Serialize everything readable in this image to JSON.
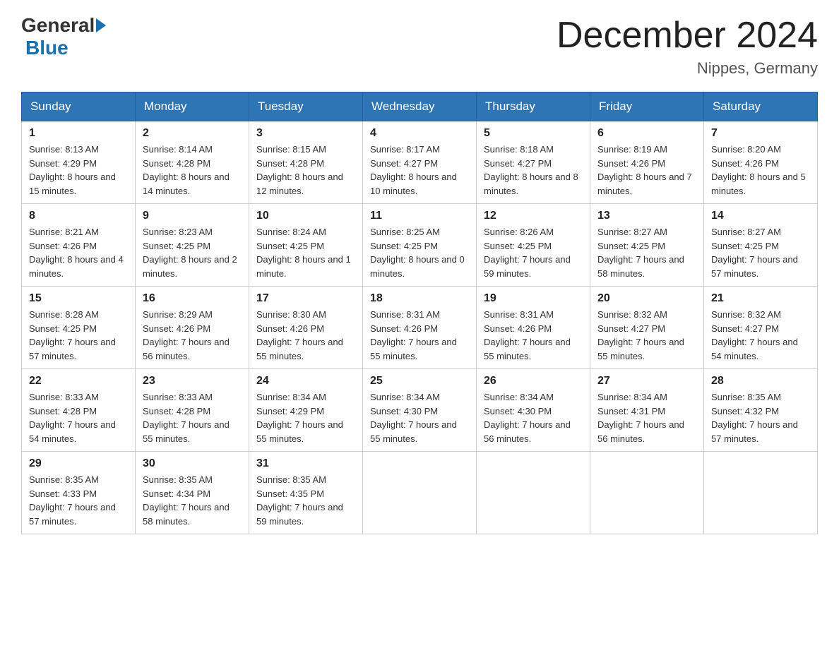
{
  "header": {
    "logo_general": "General",
    "logo_blue": "Blue",
    "month_title": "December 2024",
    "location": "Nippes, Germany"
  },
  "days_of_week": [
    "Sunday",
    "Monday",
    "Tuesday",
    "Wednesday",
    "Thursday",
    "Friday",
    "Saturday"
  ],
  "weeks": [
    [
      {
        "day": "1",
        "sunrise": "Sunrise: 8:13 AM",
        "sunset": "Sunset: 4:29 PM",
        "daylight": "Daylight: 8 hours and 15 minutes."
      },
      {
        "day": "2",
        "sunrise": "Sunrise: 8:14 AM",
        "sunset": "Sunset: 4:28 PM",
        "daylight": "Daylight: 8 hours and 14 minutes."
      },
      {
        "day": "3",
        "sunrise": "Sunrise: 8:15 AM",
        "sunset": "Sunset: 4:28 PM",
        "daylight": "Daylight: 8 hours and 12 minutes."
      },
      {
        "day": "4",
        "sunrise": "Sunrise: 8:17 AM",
        "sunset": "Sunset: 4:27 PM",
        "daylight": "Daylight: 8 hours and 10 minutes."
      },
      {
        "day": "5",
        "sunrise": "Sunrise: 8:18 AM",
        "sunset": "Sunset: 4:27 PM",
        "daylight": "Daylight: 8 hours and 8 minutes."
      },
      {
        "day": "6",
        "sunrise": "Sunrise: 8:19 AM",
        "sunset": "Sunset: 4:26 PM",
        "daylight": "Daylight: 8 hours and 7 minutes."
      },
      {
        "day": "7",
        "sunrise": "Sunrise: 8:20 AM",
        "sunset": "Sunset: 4:26 PM",
        "daylight": "Daylight: 8 hours and 5 minutes."
      }
    ],
    [
      {
        "day": "8",
        "sunrise": "Sunrise: 8:21 AM",
        "sunset": "Sunset: 4:26 PM",
        "daylight": "Daylight: 8 hours and 4 minutes."
      },
      {
        "day": "9",
        "sunrise": "Sunrise: 8:23 AM",
        "sunset": "Sunset: 4:25 PM",
        "daylight": "Daylight: 8 hours and 2 minutes."
      },
      {
        "day": "10",
        "sunrise": "Sunrise: 8:24 AM",
        "sunset": "Sunset: 4:25 PM",
        "daylight": "Daylight: 8 hours and 1 minute."
      },
      {
        "day": "11",
        "sunrise": "Sunrise: 8:25 AM",
        "sunset": "Sunset: 4:25 PM",
        "daylight": "Daylight: 8 hours and 0 minutes."
      },
      {
        "day": "12",
        "sunrise": "Sunrise: 8:26 AM",
        "sunset": "Sunset: 4:25 PM",
        "daylight": "Daylight: 7 hours and 59 minutes."
      },
      {
        "day": "13",
        "sunrise": "Sunrise: 8:27 AM",
        "sunset": "Sunset: 4:25 PM",
        "daylight": "Daylight: 7 hours and 58 minutes."
      },
      {
        "day": "14",
        "sunrise": "Sunrise: 8:27 AM",
        "sunset": "Sunset: 4:25 PM",
        "daylight": "Daylight: 7 hours and 57 minutes."
      }
    ],
    [
      {
        "day": "15",
        "sunrise": "Sunrise: 8:28 AM",
        "sunset": "Sunset: 4:25 PM",
        "daylight": "Daylight: 7 hours and 57 minutes."
      },
      {
        "day": "16",
        "sunrise": "Sunrise: 8:29 AM",
        "sunset": "Sunset: 4:26 PM",
        "daylight": "Daylight: 7 hours and 56 minutes."
      },
      {
        "day": "17",
        "sunrise": "Sunrise: 8:30 AM",
        "sunset": "Sunset: 4:26 PM",
        "daylight": "Daylight: 7 hours and 55 minutes."
      },
      {
        "day": "18",
        "sunrise": "Sunrise: 8:31 AM",
        "sunset": "Sunset: 4:26 PM",
        "daylight": "Daylight: 7 hours and 55 minutes."
      },
      {
        "day": "19",
        "sunrise": "Sunrise: 8:31 AM",
        "sunset": "Sunset: 4:26 PM",
        "daylight": "Daylight: 7 hours and 55 minutes."
      },
      {
        "day": "20",
        "sunrise": "Sunrise: 8:32 AM",
        "sunset": "Sunset: 4:27 PM",
        "daylight": "Daylight: 7 hours and 55 minutes."
      },
      {
        "day": "21",
        "sunrise": "Sunrise: 8:32 AM",
        "sunset": "Sunset: 4:27 PM",
        "daylight": "Daylight: 7 hours and 54 minutes."
      }
    ],
    [
      {
        "day": "22",
        "sunrise": "Sunrise: 8:33 AM",
        "sunset": "Sunset: 4:28 PM",
        "daylight": "Daylight: 7 hours and 54 minutes."
      },
      {
        "day": "23",
        "sunrise": "Sunrise: 8:33 AM",
        "sunset": "Sunset: 4:28 PM",
        "daylight": "Daylight: 7 hours and 55 minutes."
      },
      {
        "day": "24",
        "sunrise": "Sunrise: 8:34 AM",
        "sunset": "Sunset: 4:29 PM",
        "daylight": "Daylight: 7 hours and 55 minutes."
      },
      {
        "day": "25",
        "sunrise": "Sunrise: 8:34 AM",
        "sunset": "Sunset: 4:30 PM",
        "daylight": "Daylight: 7 hours and 55 minutes."
      },
      {
        "day": "26",
        "sunrise": "Sunrise: 8:34 AM",
        "sunset": "Sunset: 4:30 PM",
        "daylight": "Daylight: 7 hours and 56 minutes."
      },
      {
        "day": "27",
        "sunrise": "Sunrise: 8:34 AM",
        "sunset": "Sunset: 4:31 PM",
        "daylight": "Daylight: 7 hours and 56 minutes."
      },
      {
        "day": "28",
        "sunrise": "Sunrise: 8:35 AM",
        "sunset": "Sunset: 4:32 PM",
        "daylight": "Daylight: 7 hours and 57 minutes."
      }
    ],
    [
      {
        "day": "29",
        "sunrise": "Sunrise: 8:35 AM",
        "sunset": "Sunset: 4:33 PM",
        "daylight": "Daylight: 7 hours and 57 minutes."
      },
      {
        "day": "30",
        "sunrise": "Sunrise: 8:35 AM",
        "sunset": "Sunset: 4:34 PM",
        "daylight": "Daylight: 7 hours and 58 minutes."
      },
      {
        "day": "31",
        "sunrise": "Sunrise: 8:35 AM",
        "sunset": "Sunset: 4:35 PM",
        "daylight": "Daylight: 7 hours and 59 minutes."
      },
      null,
      null,
      null,
      null
    ]
  ]
}
